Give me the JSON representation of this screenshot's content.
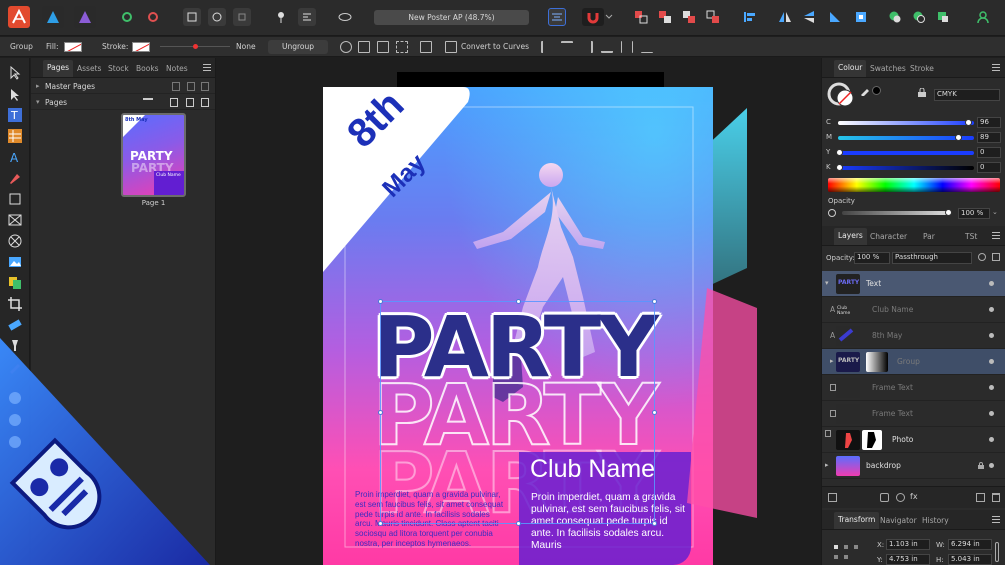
{
  "toolbar": {
    "document_title": "New Poster AP (48.7%)"
  },
  "context_bar": {
    "selection_type": "Group",
    "fill_label": "Fill:",
    "stroke_label": "Stroke:",
    "stroke_value": "None",
    "ungroup_label": "Ungroup",
    "convert_label": "Convert to Curves"
  },
  "pages_panel": {
    "tabs": [
      "Pages",
      "Assets",
      "Stock",
      "Books",
      "Notes"
    ],
    "master_pages_label": "Master Pages",
    "pages_label": "Pages",
    "page_label": "Page 1",
    "thumb_date": "8th May",
    "thumb_party": "PARTY",
    "thumb_club": "Club Name"
  },
  "poster": {
    "date_day": "8th",
    "date_month": "May",
    "party": "PARTY",
    "club_name": "Club Name",
    "club_body": "Proin imperdiet, quam a gravida pulvinar, est sem faucibus felis, sit amet consequat pede turpis id ante. In facilisis sodales arcu. Mauris",
    "left_body": "Proin imperdiet, quam a gravida pulvinar, est sem faucibus felis, sit amet consequat pede turpis id ante. In facilisis sodales arcu. Mauris tincidunt. Class aptent taciti sociosqu ad litora torquent per conubia nostra, per inceptos hymenaeos."
  },
  "colour_panel": {
    "tabs": [
      "Colour",
      "Swatches",
      "Stroke"
    ],
    "model": "CMYK",
    "channels": [
      {
        "label": "C",
        "value": "96",
        "position": 0.96,
        "color": "#26c6e8"
      },
      {
        "label": "M",
        "value": "89",
        "position": 0.89,
        "color": "#e03a9e"
      },
      {
        "label": "Y",
        "value": "0",
        "position": 0.0,
        "color": "#d9d326"
      },
      {
        "label": "K",
        "value": "0",
        "position": 0.0,
        "color": "#222222"
      }
    ],
    "opacity_label": "Opacity",
    "opacity_value": "100 %"
  },
  "layers_panel": {
    "tabs": [
      "Layers",
      "Character",
      "Par",
      "TSt"
    ],
    "opacity_label": "Opacity:",
    "opacity_value": "100 %",
    "blend_mode": "Passthrough",
    "layers": [
      {
        "name": "Text",
        "thumb_text": "PARTY",
        "state": "selected",
        "dim": false
      },
      {
        "name": "Club Name",
        "thumb_text": "Club Name",
        "state": "",
        "dim": true
      },
      {
        "name": "8th May",
        "thumb_text": "",
        "state": "",
        "dim": true
      },
      {
        "name": "Group",
        "thumb_text": "PARTY",
        "state": "selected2",
        "dim": true
      },
      {
        "name": "Frame Text",
        "thumb_text": "",
        "state": "",
        "dim": true
      },
      {
        "name": "Frame Text",
        "thumb_text": "",
        "state": "",
        "dim": true
      },
      {
        "name": "Photo",
        "thumb_text": "",
        "state": "",
        "dim": false
      },
      {
        "name": "backdrop",
        "thumb_text": "",
        "state": "",
        "dim": false
      }
    ]
  },
  "transform_panel": {
    "tabs": [
      "Transform",
      "Navigator",
      "History"
    ],
    "x_label": "X:",
    "x_value": "1.103 in",
    "y_label": "Y:",
    "y_value": "4.753 in",
    "w_label": "W:",
    "w_value": "6.294 in",
    "h_label": "H:",
    "h_value": "5.043 in"
  },
  "colors": {
    "accent": "#3d6fd8",
    "poster_blue": "#1c30b8",
    "club_purple": "#621ed2"
  }
}
